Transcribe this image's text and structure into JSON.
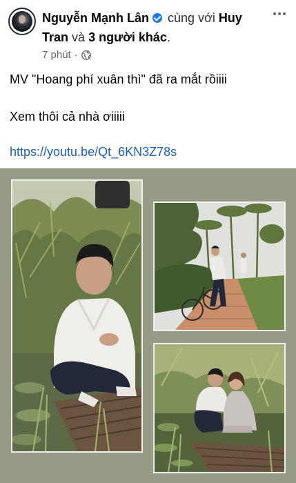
{
  "header": {
    "author_name": "Nguyễn Mạnh Lân",
    "with_text": "cùng với",
    "tagged_1_part1": "Huy",
    "tagged_1_part2": "Tran",
    "and_text": "và",
    "others_text": "3 người khác",
    "period": ".",
    "timestamp": "7 phút",
    "separator": "·",
    "privacy_icon": "globe-icon",
    "menu_icon": "more-horizontal-icon"
  },
  "post": {
    "line1": "MV \"Hoang phí xuân thì\" đã ra mắt rồiiii",
    "line2": "Xem thôi cả nhà ơiiiii",
    "link": "https://youtu.be/Qt_6KN3Z78s"
  },
  "colors": {
    "verified_badge": "#1877f2",
    "link": "#1a5fb4",
    "gallery_bg": "#959b85",
    "meta_text": "#65676b"
  }
}
